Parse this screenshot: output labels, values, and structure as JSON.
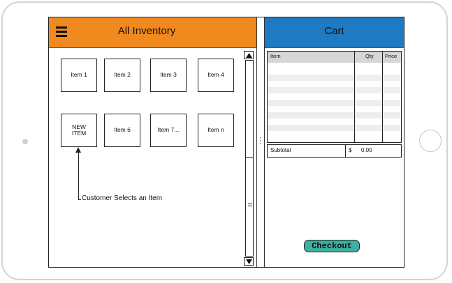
{
  "inventory": {
    "title": "All Inventory",
    "items": [
      {
        "label": "Item 1"
      },
      {
        "label": "Item 2"
      },
      {
        "label": "Item 3"
      },
      {
        "label": "Item 4"
      },
      {
        "label": "NEW\nITEM"
      },
      {
        "label": "Item 6"
      },
      {
        "label": "Item 7..."
      },
      {
        "label": "Item n"
      }
    ],
    "annotation": "Customer Selects an Item"
  },
  "cart": {
    "title": "Cart",
    "columns": [
      "Item",
      "Qty",
      "Price"
    ],
    "subtotal_label": "Subtotal",
    "currency": "$",
    "subtotal_value": "0.00",
    "checkout_label": "Checkout"
  },
  "colors": {
    "inventory_header": "#f0891e",
    "cart_header": "#1e7ac3",
    "checkout_button": "#3fb0a0"
  },
  "icons": {
    "menu": "hamburger-icon",
    "scroll_up": "triangle-up",
    "scroll_down": "triangle-down",
    "scroll_grip": "grip-lines",
    "split_handle": "vertical-dots"
  }
}
